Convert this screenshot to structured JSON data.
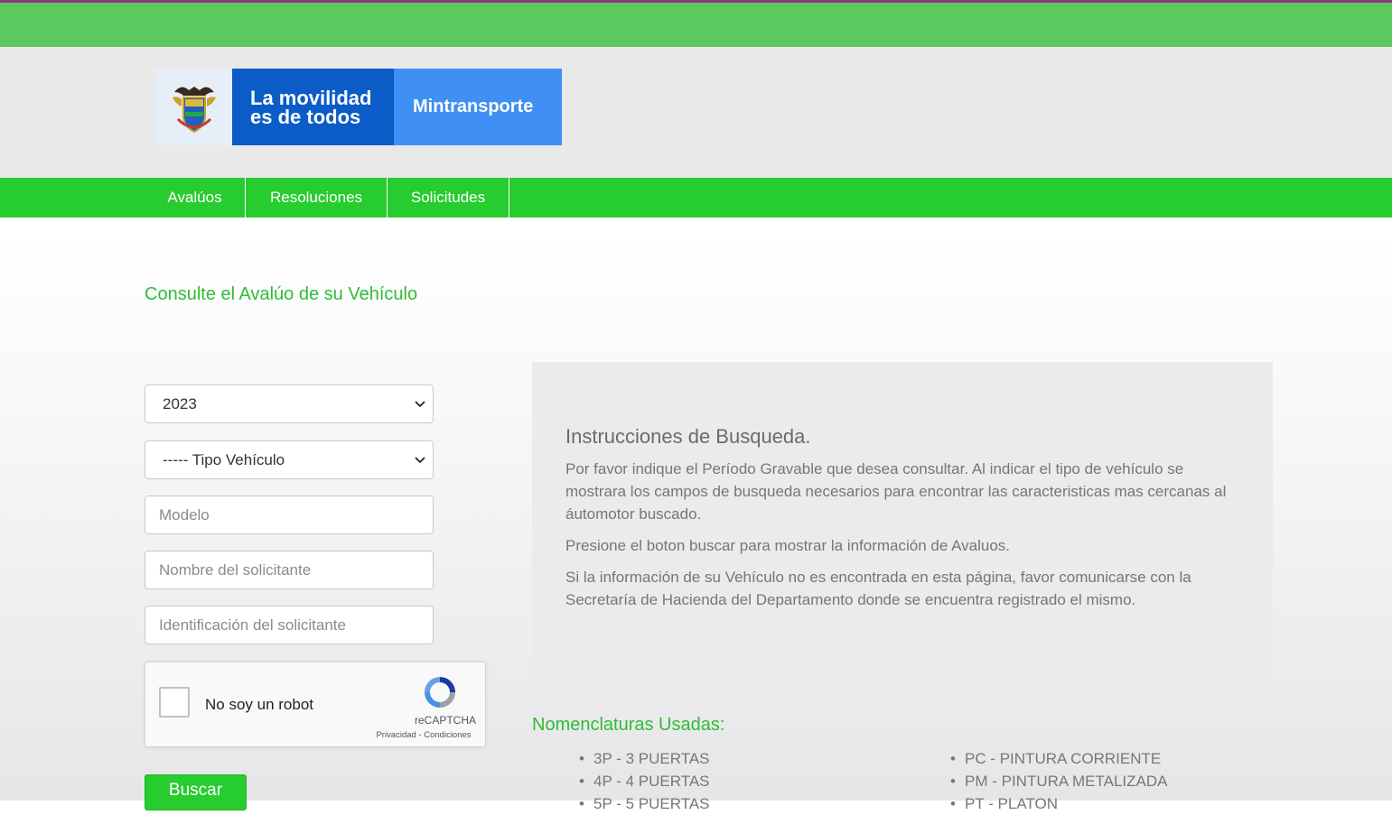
{
  "header": {
    "logo": {
      "emblem": "colombia-coat-of-arms-icon",
      "slogan_line1": "La movilidad",
      "slogan_line2": "es de todos",
      "ministry": "Mintransporte"
    }
  },
  "nav": {
    "items": [
      {
        "label": "Avalúos"
      },
      {
        "label": "Resoluciones"
      },
      {
        "label": "Solicitudes"
      }
    ]
  },
  "main": {
    "title": "Consulte el Avalúo de su Vehículo"
  },
  "form": {
    "year_select": {
      "value": "2023"
    },
    "vehicle_type_select": {
      "value": "----- Tipo Vehículo"
    },
    "model_input": {
      "placeholder": "Modelo"
    },
    "name_input": {
      "placeholder": "Nombre del solicitante"
    },
    "id_input": {
      "placeholder": "Identificación del solicitante"
    },
    "captcha": {
      "label": "No soy un robot",
      "brand": "reCAPTCHA",
      "privacy": "Privacidad",
      "separator": " - ",
      "terms": "Condiciones"
    },
    "submit_label": "Buscar"
  },
  "instructions": {
    "title": "Instrucciones de Busqueda.",
    "paragraphs": [
      "Por favor indique el Período Gravable que desea consultar. Al indicar el tipo de vehículo se mostrara los campos de busqueda necesarios para encontrar las caracteristicas mas cercanas al áutomotor buscado.",
      "Presione el boton buscar para mostrar la información de Avaluos.",
      "Si la información de su Vehículo no es encontrada en esta página, favor comunicarse con la Secretaría de Hacienda del Departamento donde se encuentra registrado el mismo."
    ]
  },
  "nomenclature": {
    "title": "Nomenclaturas Usadas:",
    "left": [
      "3P - 3 PUERTAS",
      "4P - 4 PUERTAS",
      "5P - 5 PUERTAS"
    ],
    "right": [
      "PC - PINTURA CORRIENTE",
      "PM - PINTURA METALIZADA",
      "PT - PLATON"
    ]
  },
  "colors": {
    "nav_green": "#27cc2e",
    "top_green": "#5cc95f",
    "title_green": "#2fbd35",
    "logo_dark_blue": "#0b5cc7",
    "logo_light_blue": "#3f8ff5"
  }
}
